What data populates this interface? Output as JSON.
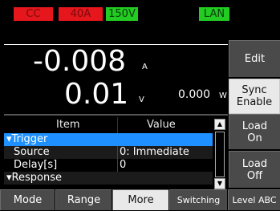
{
  "status": {
    "mode_badge": "CC",
    "current_range": "40A",
    "voltage_range": "150V",
    "lan": "LAN"
  },
  "measure": {
    "current_value": "-0.008",
    "current_unit": "A",
    "voltage_value": "0.01",
    "voltage_unit": "V",
    "power_value": "0.000",
    "power_unit": "W"
  },
  "table": {
    "headers": [
      "Item",
      "Value"
    ],
    "rows": [
      {
        "item": "▾Trigger",
        "value": ""
      },
      {
        "item": "Source",
        "value": "0: Immediate"
      },
      {
        "item": "Delay[s]",
        "value": "0"
      },
      {
        "item": "▾Response",
        "value": ""
      }
    ]
  },
  "softkeys_right": {
    "edit": "Edit",
    "sync_line1": "Sync",
    "sync_line2": "Enable",
    "load_on_line1": "Load",
    "load_on_line2": "On",
    "load_off_line1": "Load",
    "load_off_line2": "Off"
  },
  "softkeys_bottom": {
    "mode": "Mode",
    "range": "Range",
    "more": "More",
    "switching": "Switching",
    "level_abc": "Level ABC"
  },
  "colors": {
    "alarm_red": "#e5161c",
    "ok_green": "#22cc22",
    "selected_row": "#1e90ff",
    "softkey_gray": "#4a4a4a",
    "softkey_active": "#e9e9e9"
  }
}
